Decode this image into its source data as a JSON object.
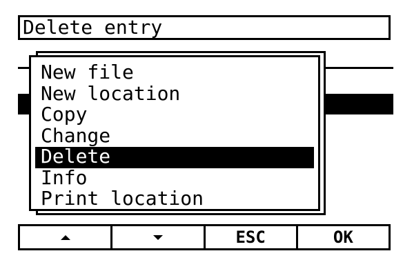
{
  "title": "Delete entry",
  "menu": {
    "items": [
      {
        "label": "New file"
      },
      {
        "label": "New location"
      },
      {
        "label": "Copy"
      },
      {
        "label": "Change"
      },
      {
        "label": "Delete",
        "selected": true
      },
      {
        "label": "Info"
      },
      {
        "label": "Print location"
      }
    ]
  },
  "softkeys": {
    "up_icon": "triangle-up-icon",
    "down_icon": "triangle-down-icon",
    "esc_label": "ESC",
    "ok_label": "OK"
  }
}
